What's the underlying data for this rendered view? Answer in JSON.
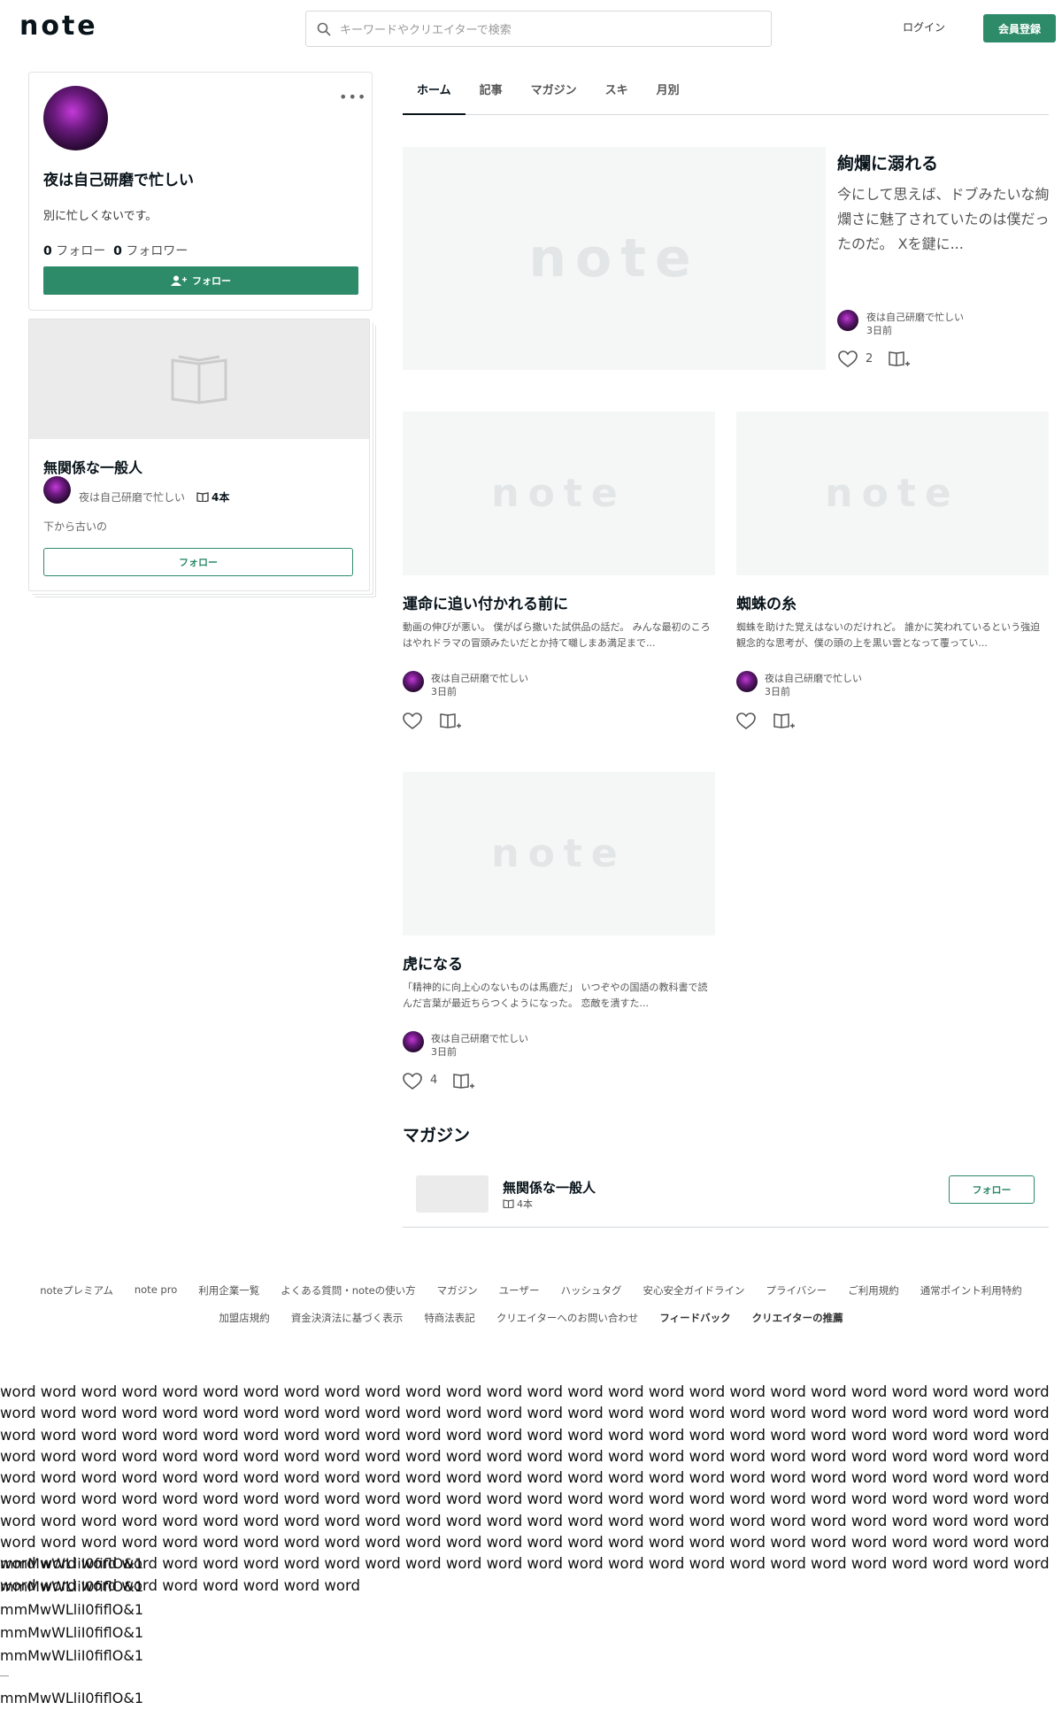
{
  "header": {
    "logo": "note",
    "search_placeholder": "キーワードやクリエイターで検索",
    "login": "ログイン",
    "signup": "会員登録"
  },
  "profile": {
    "name": "夜は自己研磨で忙しい",
    "description": "別に忙しくないです。",
    "following_count": "0",
    "following_label": "フォロー",
    "followers_count": "0",
    "followers_label": "フォロワー",
    "follow_button": "フォロー",
    "menu": "•••"
  },
  "magazine_card": {
    "title": "無関係な一般人",
    "author": "夜は自己研磨で忙しい",
    "count": "4本",
    "description": "下から古いの",
    "follow_button": "フォロー"
  },
  "tabs": [
    "ホーム",
    "記事",
    "マガジン",
    "スキ",
    "月別"
  ],
  "placeholder_logo": "note",
  "featured": {
    "title": "絢爛に溺れる",
    "excerpt": "今にして思えば、ドブみたいな絢爛さに魅了されていたのは僕だったのだ。 Xを鍵に...",
    "author": "夜は自己研磨で忙しい",
    "date": "3日前",
    "likes": "2"
  },
  "articles": [
    {
      "title": "運命に追い付かれる前に",
      "excerpt": "動画の伸びが悪い。 僕がばら撒いた試供品の話だ。 みんな最初のころはやれドラマの冒頭みたいだとか持て囃しまあ満足まで...",
      "author": "夜は自己研磨で忙しい",
      "date": "3日前",
      "likes": ""
    },
    {
      "title": "蜘蛛の糸",
      "excerpt": "蜘蛛を助けた覚えはないのだけれど。 誰かに笑われているという強迫観念的な思考が、僕の頭の上を黒い雲となって覆ってい...",
      "author": "夜は自己研磨で忙しい",
      "date": "3日前",
      "likes": ""
    },
    {
      "title": "虎になる",
      "excerpt": "「精神的に向上心のないものは馬鹿だ」 いつぞやの国語の教科書で読んだ言葉が最近ちらつくようになった。 恋敵を潰すた...",
      "author": "夜は自己研磨で忙しい",
      "date": "3日前",
      "likes": "4"
    }
  ],
  "magazine_section": {
    "heading": "マガジン",
    "title": "無関係な一般人",
    "count": "4本",
    "follow_button": "フォロー"
  },
  "footer": {
    "row1": [
      "noteプレミアム",
      "note pro",
      "利用企業一覧",
      "よくある質問・noteの使い方",
      "マガジン",
      "ユーザー",
      "ハッシュタグ",
      "安心安全ガイドライン",
      "プライバシー",
      "ご利用規約",
      "通常ポイント利用特約"
    ],
    "row2": [
      "加盟店規約",
      "資金決済法に基づく表示",
      "特商法表記",
      "クリエイターへのお問い合わせ",
      "フィードバック",
      "クリエイターの推薦"
    ]
  },
  "filler_words": "word word word word word word word word word word word word word word word word word word word word word word word word word word word word word word word word word word word word word word word word word word word word word word word word word word word word word word word word word word word word word word word word word word word word word word word word word word word word word word word word word word word word word word word word word word word word word word word word word word word word word word word word word word word word word word word word word word word word word word word word word word word word word word word word word word word word word word word word word word word word word word word word word word word word word word word word word word word word word word word word word word word word word word word word word word word word word word word word word word word word word word word word word word word word word word word word word word word word word word word word word word word word word word word word word word word word word word word word word word word word word word word word word word word word word word word word word word word word word word word word word word word",
  "filler_lines": [
    "mmMwWLliI0fiflO&1",
    "mmMwWLliI0fiflO&1",
    "mmMwWLliI0fiflO&1",
    "mmMwWLliI0fiflO&1",
    "mmMwWLliI0fiflO&1",
    "mmMwWLliI0fiflO&1"
  ],
  "colors": {
    "accent": "#2e8b6a",
    "text": "#08131a"
  }
}
